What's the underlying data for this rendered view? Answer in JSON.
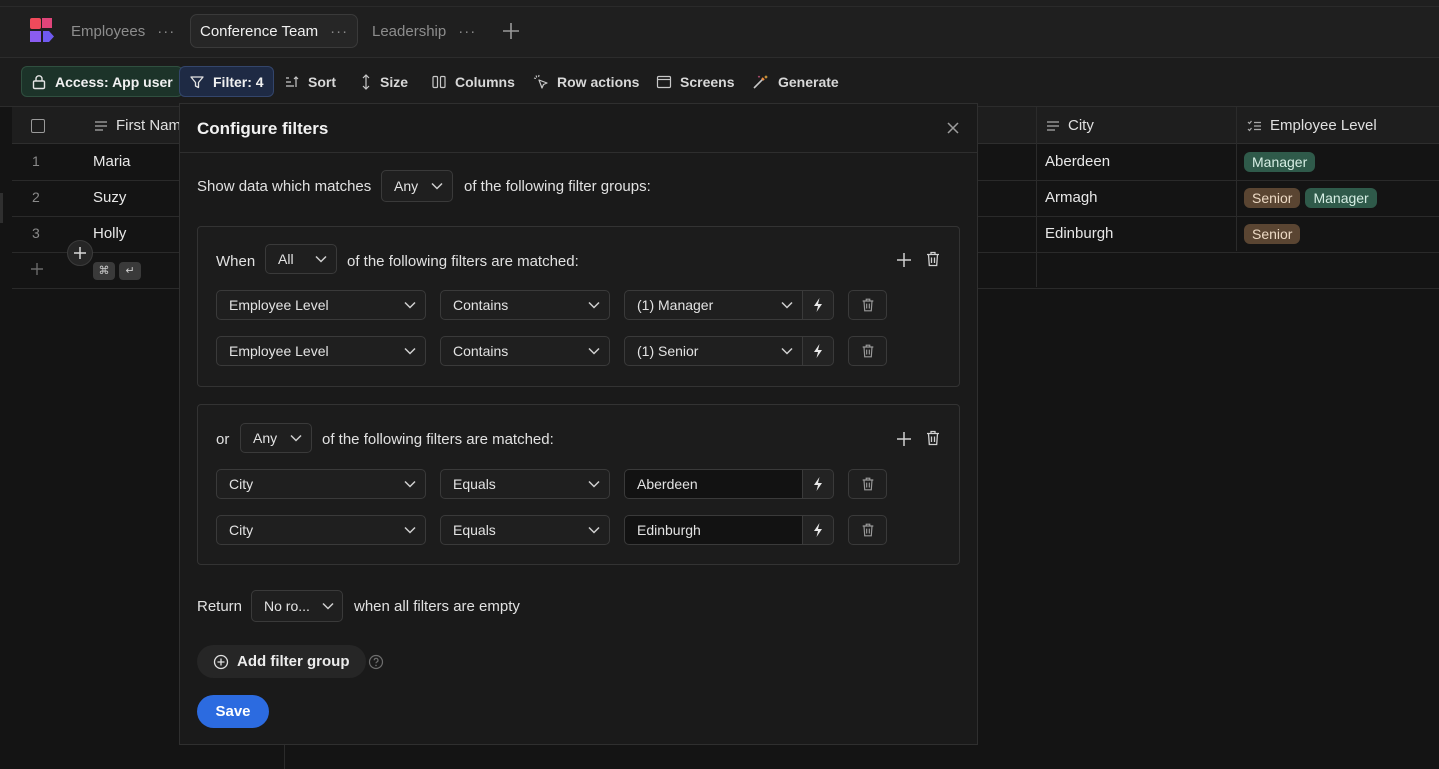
{
  "tabs": [
    {
      "label": "Employees",
      "menu": "···"
    },
    {
      "label": "Conference Team",
      "menu": "···"
    },
    {
      "label": "Leadership",
      "menu": "···"
    }
  ],
  "toolbar": {
    "access": "Access: App user",
    "filter": "Filter: 4",
    "sort": "Sort",
    "size": "Size",
    "columns": "Columns",
    "row_actions": "Row actions",
    "screens": "Screens",
    "generate": "Generate"
  },
  "grid": {
    "columns": [
      "First Nam",
      "City",
      "Employee Level"
    ],
    "rows": [
      {
        "num": "1",
        "first": "Maria",
        "city": "Aberdeen",
        "levels": [
          "Manager"
        ]
      },
      {
        "num": "2",
        "first": "Suzy",
        "city": "Armagh",
        "levels": [
          "Senior",
          "Manager"
        ]
      },
      {
        "num": "3",
        "first": "Holly",
        "city": "Edinburgh",
        "levels": [
          "Senior"
        ]
      }
    ],
    "shortcut_keys": [
      "⌘",
      "↵"
    ]
  },
  "modal": {
    "title": "Configure filters",
    "show_prefix": "Show data which matches",
    "show_match": "Any",
    "show_suffix": "of the following filter groups:",
    "groups": [
      {
        "prefix": "When",
        "match": "All",
        "suffix": "of the following filters are matched:",
        "filters": [
          {
            "field": "Employee Level",
            "op": "Contains",
            "value": "(1) Manager"
          },
          {
            "field": "Employee Level",
            "op": "Contains",
            "value": "(1) Senior"
          }
        ]
      },
      {
        "prefix": "or",
        "match": "Any",
        "suffix": "of the following filters are matched:",
        "filters": [
          {
            "field": "City",
            "op": "Equals",
            "value": "Aberdeen"
          },
          {
            "field": "City",
            "op": "Equals",
            "value": "Edinburgh"
          }
        ]
      }
    ],
    "return_label": "Return",
    "return_value": "No ro...",
    "return_suffix": "when all filters are empty",
    "add_group": "Add filter group",
    "save": "Save"
  },
  "colors": {
    "accent": "#2c6be0",
    "manager_tag": "#2f5a4a",
    "senior_tag": "#5a4532",
    "access_bg": "#1c3329",
    "filter_bg": "#1e2a44"
  }
}
